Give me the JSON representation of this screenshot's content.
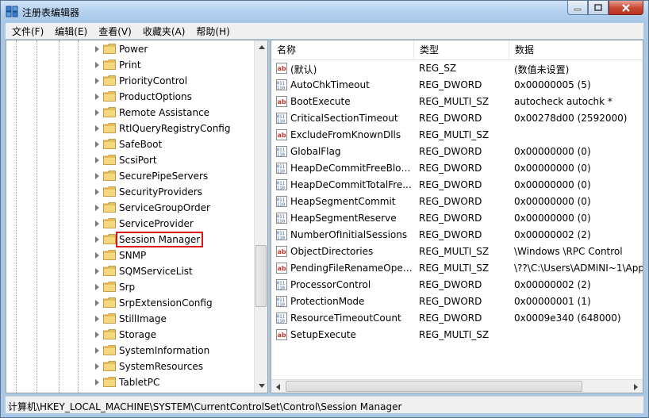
{
  "window": {
    "title": "注册表编辑器"
  },
  "menu": [
    "文件(F)",
    "编辑(E)",
    "查看(V)",
    "收藏夹(A)",
    "帮助(H)"
  ],
  "tree": {
    "items": [
      {
        "label": "Power",
        "icon": "folder-icon"
      },
      {
        "label": "Print",
        "icon": "folder-icon"
      },
      {
        "label": "PriorityControl",
        "icon": "folder-icon"
      },
      {
        "label": "ProductOptions",
        "icon": "folder-icon"
      },
      {
        "label": "Remote Assistance",
        "icon": "folder-icon"
      },
      {
        "label": "RtlQueryRegistryConfig",
        "icon": "folder-icon"
      },
      {
        "label": "SafeBoot",
        "icon": "folder-icon"
      },
      {
        "label": "ScsiPort",
        "icon": "folder-icon"
      },
      {
        "label": "SecurePipeServers",
        "icon": "folder-icon"
      },
      {
        "label": "SecurityProviders",
        "icon": "folder-icon"
      },
      {
        "label": "ServiceGroupOrder",
        "icon": "folder-icon"
      },
      {
        "label": "ServiceProvider",
        "icon": "folder-icon"
      },
      {
        "label": "Session Manager",
        "icon": "folder-icon",
        "selected": true
      },
      {
        "label": "SNMP",
        "icon": "folder-icon"
      },
      {
        "label": "SQMServiceList",
        "icon": "folder-icon"
      },
      {
        "label": "Srp",
        "icon": "folder-icon"
      },
      {
        "label": "SrpExtensionConfig",
        "icon": "folder-icon"
      },
      {
        "label": "StillImage",
        "icon": "folder-icon"
      },
      {
        "label": "Storage",
        "icon": "folder-icon"
      },
      {
        "label": "SystemInformation",
        "icon": "folder-icon"
      },
      {
        "label": "SystemResources",
        "icon": "folder-icon"
      },
      {
        "label": "TabletPC",
        "icon": "folder-icon"
      }
    ]
  },
  "columns": {
    "name": "名称",
    "type": "类型",
    "data": "数据"
  },
  "values": [
    {
      "name": "(默认)",
      "type": "REG_SZ",
      "data": "(数值未设置)",
      "icon": "string-value-icon"
    },
    {
      "name": "AutoChkTimeout",
      "type": "REG_DWORD",
      "data": "0x00000005 (5)",
      "icon": "binary-value-icon"
    },
    {
      "name": "BootExecute",
      "type": "REG_MULTI_SZ",
      "data": "autocheck autochk *",
      "icon": "string-value-icon"
    },
    {
      "name": "CriticalSectionTimeout",
      "type": "REG_DWORD",
      "data": "0x00278d00 (2592000)",
      "icon": "binary-value-icon"
    },
    {
      "name": "ExcludeFromKnownDlls",
      "type": "REG_MULTI_SZ",
      "data": "",
      "icon": "string-value-icon"
    },
    {
      "name": "GlobalFlag",
      "type": "REG_DWORD",
      "data": "0x00000000 (0)",
      "icon": "binary-value-icon"
    },
    {
      "name": "HeapDeCommitFreeBloc...",
      "type": "REG_DWORD",
      "data": "0x00000000 (0)",
      "icon": "binary-value-icon"
    },
    {
      "name": "HeapDeCommitTotalFre...",
      "type": "REG_DWORD",
      "data": "0x00000000 (0)",
      "icon": "binary-value-icon"
    },
    {
      "name": "HeapSegmentCommit",
      "type": "REG_DWORD",
      "data": "0x00000000 (0)",
      "icon": "binary-value-icon"
    },
    {
      "name": "HeapSegmentReserve",
      "type": "REG_DWORD",
      "data": "0x00000000 (0)",
      "icon": "binary-value-icon"
    },
    {
      "name": "NumberOfInitialSessions",
      "type": "REG_DWORD",
      "data": "0x00000002 (2)",
      "icon": "binary-value-icon"
    },
    {
      "name": "ObjectDirectories",
      "type": "REG_MULTI_SZ",
      "data": "\\Windows \\RPC Control",
      "icon": "string-value-icon"
    },
    {
      "name": "PendingFileRenameOper...",
      "type": "REG_MULTI_SZ",
      "data": "\\??\\C:\\Users\\ADMINI~1\\App",
      "icon": "string-value-icon"
    },
    {
      "name": "ProcessorControl",
      "type": "REG_DWORD",
      "data": "0x00000002 (2)",
      "icon": "binary-value-icon"
    },
    {
      "name": "ProtectionMode",
      "type": "REG_DWORD",
      "data": "0x00000001 (1)",
      "icon": "binary-value-icon"
    },
    {
      "name": "ResourceTimeoutCount",
      "type": "REG_DWORD",
      "data": "0x0009e340 (648000)",
      "icon": "binary-value-icon"
    },
    {
      "name": "SetupExecute",
      "type": "REG_MULTI_SZ",
      "data": "",
      "icon": "string-value-icon"
    }
  ],
  "status": {
    "path": "计算机\\HKEY_LOCAL_MACHINE\\SYSTEM\\CurrentControlSet\\Control\\Session Manager"
  }
}
